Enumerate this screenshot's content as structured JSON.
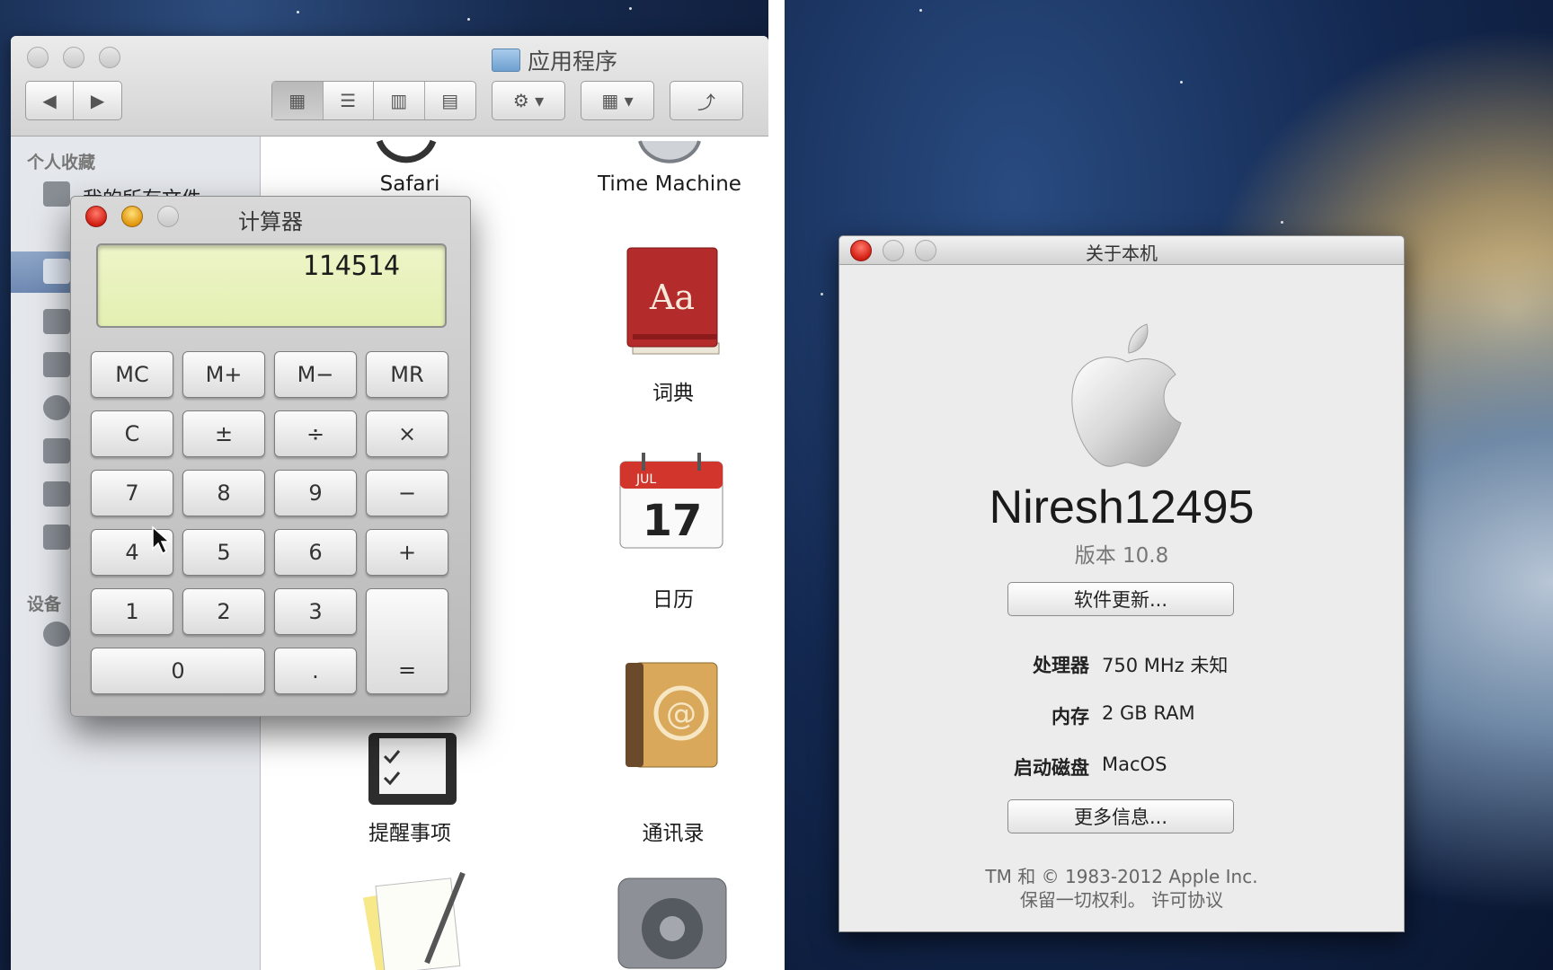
{
  "finder": {
    "title": "应用程序",
    "sidebar": {
      "favorites_heading": "个人收藏",
      "first_item_label": "我的所有文件",
      "devices_heading": "设备"
    },
    "apps": [
      {
        "label": "Safari",
        "icon": "safari-icon"
      },
      {
        "label": "Time Machine",
        "icon": "time-machine-icon"
      },
      {
        "label": "词典",
        "icon": "dictionary-icon"
      },
      {
        "label": "日历",
        "icon": "calendar-icon",
        "month": "JUL",
        "day": "17"
      },
      {
        "label": "提醒事项",
        "icon": "reminders-icon"
      },
      {
        "label": "通讯录",
        "icon": "contacts-icon"
      },
      {
        "label": "",
        "icon": "textedit-icon"
      },
      {
        "label": "",
        "icon": "system-preferences-icon"
      }
    ],
    "dictionary_cover_text": "Aa"
  },
  "calculator": {
    "title": "计算器",
    "display": "114514",
    "keys": {
      "mc": "MC",
      "mplus": "M+",
      "mminus": "M−",
      "mr": "MR",
      "clear": "C",
      "sign": "±",
      "divide": "÷",
      "multiply": "×",
      "k7": "7",
      "k8": "8",
      "k9": "9",
      "minus": "−",
      "k4": "4",
      "k5": "5",
      "k6": "6",
      "plus": "+",
      "k1": "1",
      "k2": "2",
      "k3": "3",
      "equals": "=",
      "k0": "0",
      "decimal": "."
    }
  },
  "about": {
    "title": "关于本机",
    "os_name": "Niresh12495",
    "version": "版本 10.8",
    "software_update": "软件更新...",
    "processor_label": "处理器",
    "processor_value": "750 MHz 未知",
    "memory_label": "内存",
    "memory_value": "2 GB RAM",
    "startup_disk_label": "启动磁盘",
    "startup_disk_value": "MacOS",
    "more_info": "更多信息...",
    "copyright_line1": "TM 和 © 1983-2012 Apple Inc.",
    "copyright_line2": "保留一切权利。 许可协议"
  },
  "colors": {
    "calc_display_bg": "#e9f2bd",
    "close_red": "#e0392c",
    "minimize_yellow": "#f0b021",
    "sidebar_selected": "#7a93bb"
  }
}
